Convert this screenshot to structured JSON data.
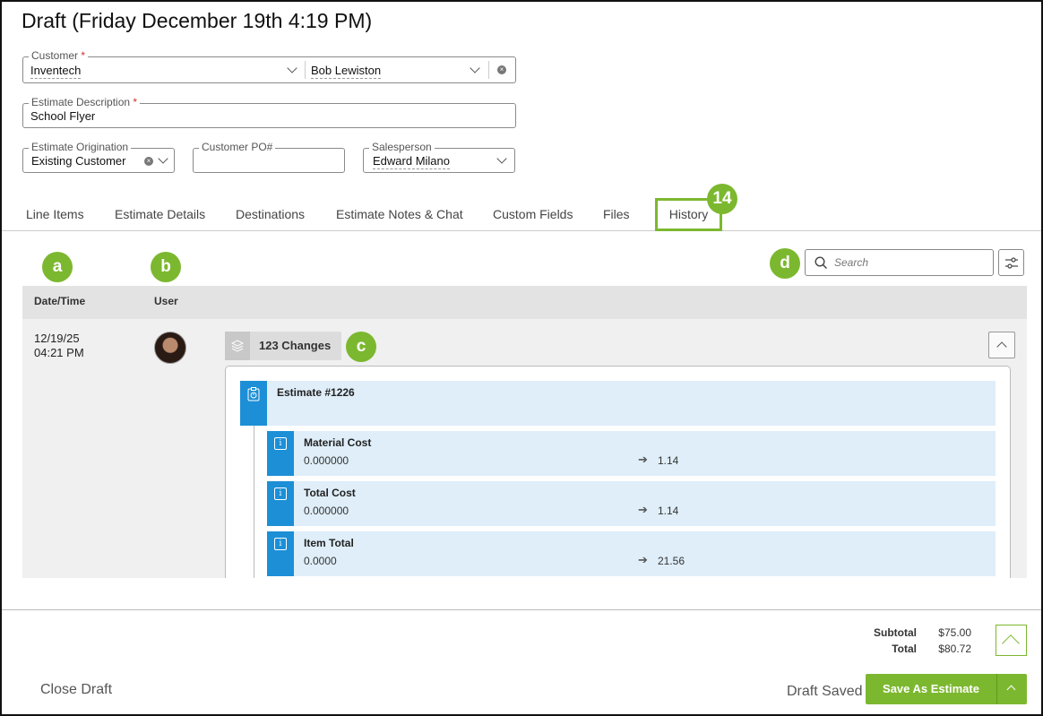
{
  "page": {
    "title": "Draft (Friday December 19th 4:19 PM)"
  },
  "form": {
    "customer": {
      "label": "Customer",
      "required_mark": "*",
      "value": "Inventech",
      "contact": "Bob Lewiston"
    },
    "description": {
      "label": "Estimate Description",
      "required_mark": "*",
      "value": "School Flyer"
    },
    "origination": {
      "label": "Estimate Origination",
      "value": "Existing Customer"
    },
    "po": {
      "label": "Customer PO#",
      "value": ""
    },
    "salesperson": {
      "label": "Salesperson",
      "value": "Edward Milano"
    }
  },
  "tabs": [
    "Line Items",
    "Estimate Details",
    "Destinations",
    "Estimate Notes & Chat",
    "Custom Fields",
    "Files",
    "History"
  ],
  "callouts": {
    "tab_badge": "14",
    "a": "a",
    "b": "b",
    "c": "c",
    "d": "d"
  },
  "history": {
    "search_placeholder": "Search",
    "columns": {
      "datetime": "Date/Time",
      "user": "User"
    },
    "row": {
      "date": "12/19/25",
      "time": "04:21 PM",
      "changes_label": "123 Changes",
      "group_title": "Estimate #1226",
      "entries": [
        {
          "field": "Material Cost",
          "old": "0.000000",
          "new": "1.14"
        },
        {
          "field": "Total Cost",
          "old": "0.000000",
          "new": "1.14"
        },
        {
          "field": "Item Total",
          "old": "0.0000",
          "new": "21.56"
        }
      ]
    }
  },
  "footer": {
    "subtotal_label": "Subtotal",
    "subtotal": "$75.00",
    "total_label": "Total",
    "total": "$80.72",
    "close_draft": "Close Draft",
    "draft_saved": "Draft Saved",
    "save_button": "Save As Estimate"
  },
  "colors": {
    "accent_green": "#7cb82f",
    "entry_blue": "#1c8fd6",
    "entry_bg": "#dfeef9"
  },
  "icons": [
    "chevron-down-icon",
    "clear-icon",
    "search-icon",
    "filter-icon",
    "layers-icon",
    "chevron-up-icon",
    "estimate-icon",
    "info-icon",
    "arrow-right-icon"
  ]
}
